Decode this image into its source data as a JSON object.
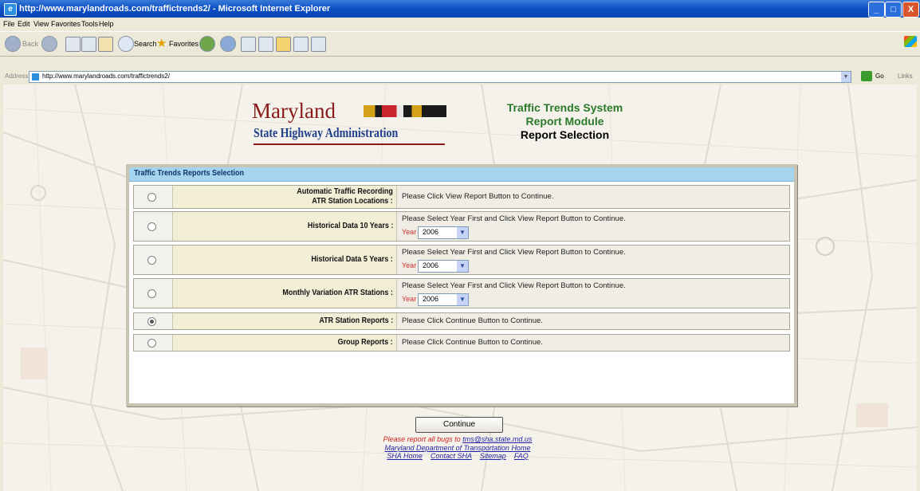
{
  "window": {
    "title": "http://www.marylandroads.com/traffictrends2/ - Microsoft Internet Explorer",
    "controls": {
      "minimize": "_",
      "maximize": "□",
      "close": "X"
    }
  },
  "menu": [
    "File",
    "Edit",
    "View",
    "Favorites",
    "Tools",
    "Help"
  ],
  "toolbar": {
    "back": "Back",
    "search": "Search",
    "favorites": "Favorites"
  },
  "address": {
    "label": "Address",
    "url": "http://www.marylandroads.com/traffictrends2/",
    "go": "Go",
    "links": "Links"
  },
  "logo": {
    "line1": "Maryland",
    "line2": "State Highway Administration"
  },
  "system": {
    "line1": "Traffic Trends System",
    "line2": "Report Module",
    "line3": "Report Selection"
  },
  "panel": {
    "title": "Traffic Trends Reports Selection",
    "rows": [
      {
        "label": [
          "Automatic Traffic Recording",
          "ATR Station Locations :"
        ],
        "message": "Please Click View Report Button to Continue.",
        "checked": false,
        "has_year": false
      },
      {
        "label": [
          "Historical Data 10 Years :"
        ],
        "message": "Please Select Year First and Click View Report Button to Continue.",
        "checked": false,
        "has_year": true,
        "year_label": "Year :",
        "year": "2006"
      },
      {
        "label": [
          "Historical Data 5 Years :"
        ],
        "message": "Please Select Year First and Click View Report Button to Continue.",
        "checked": false,
        "has_year": true,
        "year_label": "Year :",
        "year": "2006"
      },
      {
        "label": [
          "Monthly Variation ATR Stations :"
        ],
        "message": "Please Select Year First and Click View Report Button to Continue.",
        "checked": false,
        "has_year": true,
        "year_label": "Year :",
        "year": "2006"
      },
      {
        "label": [
          "ATR Station Reports :"
        ],
        "message": "Please Click Continue Button to Continue.",
        "checked": true,
        "has_year": false
      },
      {
        "label": [
          "Group Reports :"
        ],
        "message": "Please Click Continue Button to Continue.",
        "checked": false,
        "has_year": false
      }
    ]
  },
  "continue_label": "Continue",
  "footer": {
    "bug_text": "Please report all bugs to",
    "bug_email": "tms@sha.state.md.us",
    "mdot_link": "Maryland Department of Transportation Home",
    "links": [
      "SHA Home",
      "Contact SHA",
      "Sitemap",
      "FAQ"
    ]
  },
  "colors": {
    "accent": "#a5d4ee",
    "title_green": "#2b7a2b",
    "footer_red": "#d4201e",
    "link_blue": "#1f1fa8"
  }
}
